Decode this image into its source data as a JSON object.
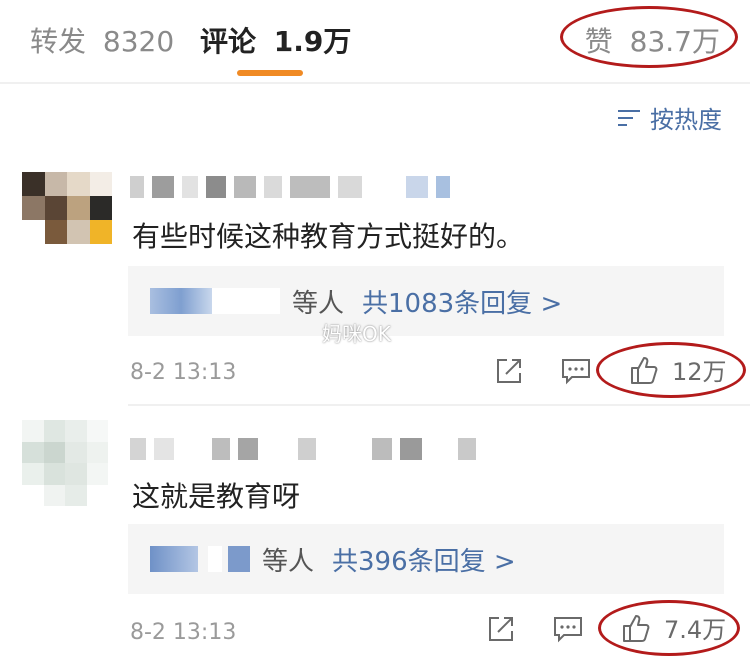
{
  "tabs": [
    {
      "label": "转发",
      "count": "8320"
    },
    {
      "label": "评论",
      "count": "1.9万"
    }
  ],
  "likes_label": "赞",
  "likes_count": "83.7万",
  "sort_label": "按热度",
  "watermark": "妈咪OK",
  "comments": [
    {
      "text": "有些时候这种教育方式挺好的。",
      "reply_suffix": "等人",
      "reply_count": "共1083条回复 >",
      "time": "8-2 13:13",
      "likes": "12万"
    },
    {
      "text": "这就是教育呀",
      "reply_suffix": "等人",
      "reply_count": "共396条回复 >",
      "time": "8-2 13:13",
      "likes": "7.4万"
    }
  ],
  "colors": {
    "accent": "#f08a24",
    "link": "#4a6fa5",
    "annotation": "#b31b1b"
  }
}
